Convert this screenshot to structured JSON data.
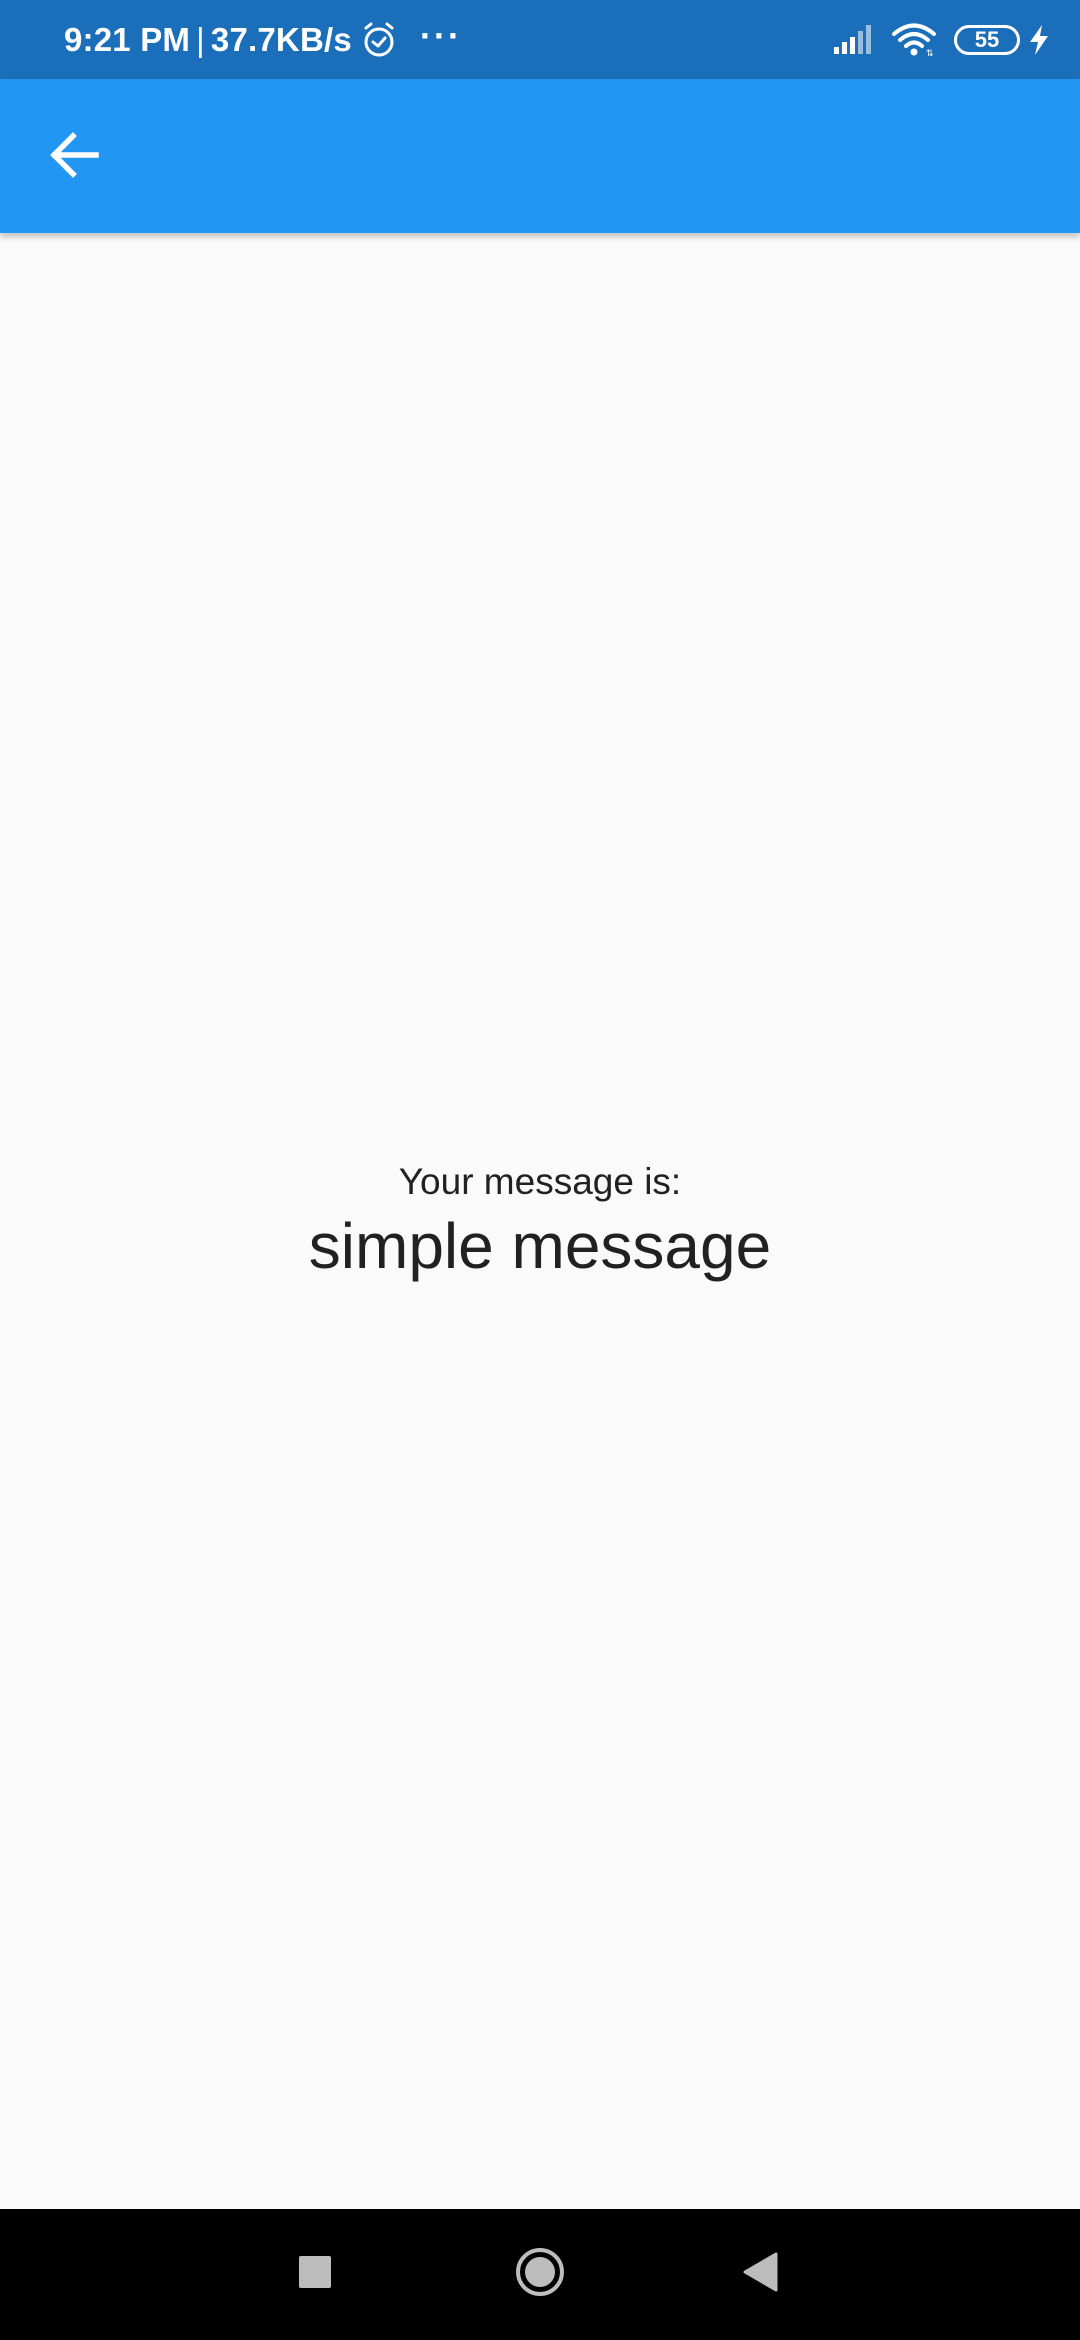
{
  "status_bar": {
    "time": "9:21 PM",
    "separator": "|",
    "net_speed": "37.7KB/s",
    "dots": "···",
    "battery_level": "55",
    "icons": [
      "alarm-icon",
      "cellular-signal-icon",
      "wifi-icon",
      "battery-icon",
      "charging-bolt-icon"
    ]
  },
  "app_bar": {
    "back_icon": "arrow-back-icon",
    "color": "#2196F3"
  },
  "main": {
    "label": "Your message is:",
    "message": "simple message"
  },
  "nav_bar": {
    "buttons": [
      "recents-square-icon",
      "home-circle-icon",
      "back-triangle-icon"
    ]
  },
  "colors": {
    "status_bar": "#1B6FBA",
    "app_bar": "#2196F3",
    "background": "#FAFAFA",
    "text": "#212121",
    "nav_bar": "#000000"
  }
}
